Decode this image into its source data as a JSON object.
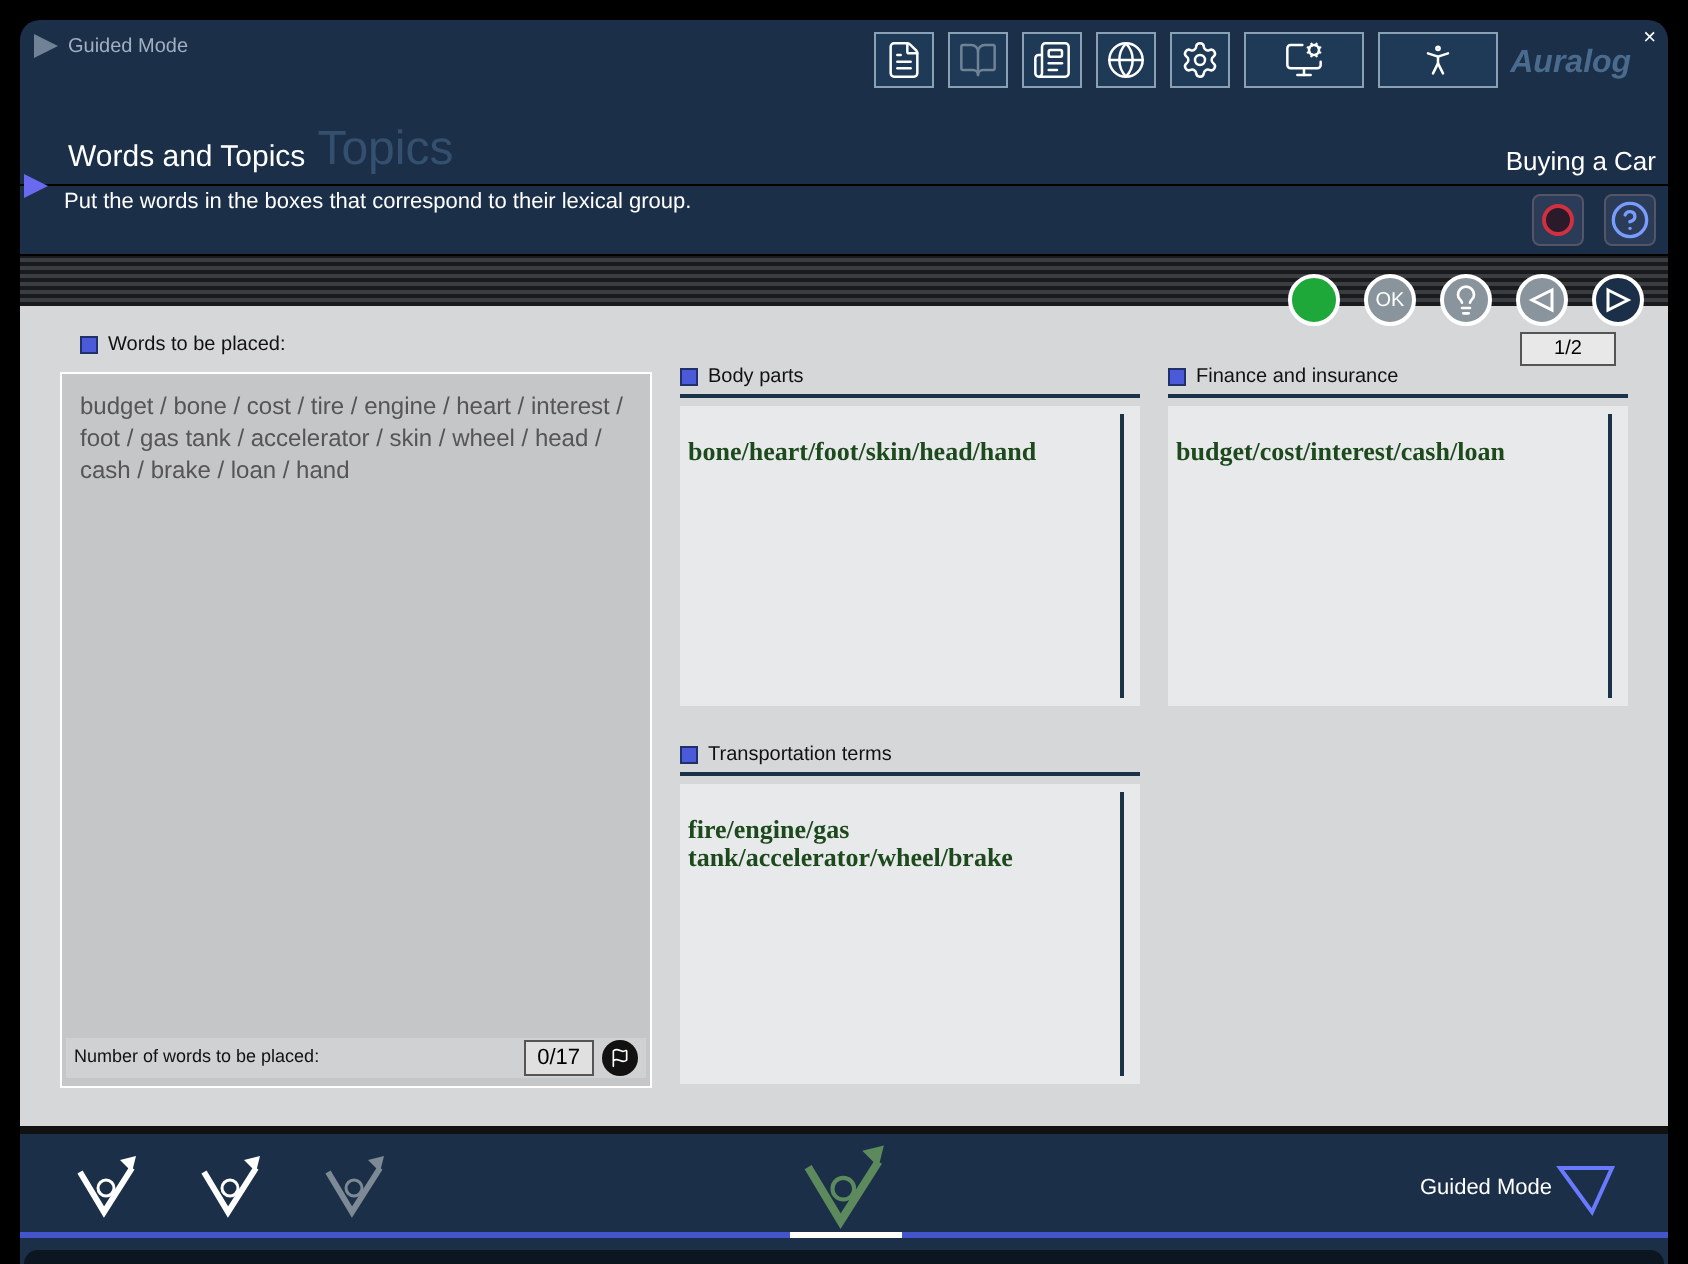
{
  "window": {
    "title": "Guided Mode",
    "brand": "Auralog",
    "close": "×"
  },
  "header": {
    "ghost_title": "Topics",
    "title": "Words and Topics",
    "instruction": "Put the words in the boxes that correspond to their lexical group.",
    "lesson": "Buying a Car"
  },
  "controls": {
    "status_on": true,
    "ok": "OK",
    "page": "1/2"
  },
  "words_panel": {
    "label": "Words to be placed:",
    "text": "budget / bone / cost / tire / engine / heart / interest / foot / gas tank / accelerator / skin / wheel / head / cash / brake / loan / hand",
    "counter_label": "Number of words to be placed:",
    "counter": "0/17"
  },
  "groups": [
    {
      "title": "Body parts",
      "content": "bone/heart/foot/skin/head/hand"
    },
    {
      "title": "Finance and insurance",
      "content": "budget/cost/interest/cash/loan"
    },
    {
      "title": "Transportation terms",
      "content": "fire/engine/gas tank/accelerator/wheel/brake"
    }
  ],
  "bottom_nav": {
    "tools": [
      {
        "selected": false,
        "disabled": false
      },
      {
        "selected": false,
        "disabled": false
      },
      {
        "selected": false,
        "disabled": true
      },
      {
        "selected": true,
        "disabled": false
      }
    ],
    "mode": "Guided Mode"
  }
}
